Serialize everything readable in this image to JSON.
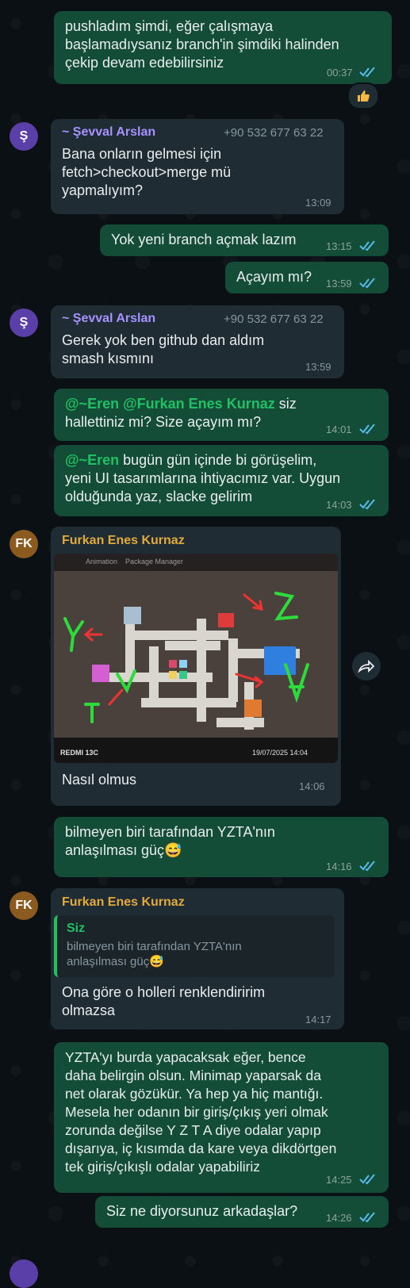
{
  "colors": {
    "outgoing": "#134d37",
    "incoming": "#1f2c33",
    "sevval": "#a792ff",
    "furkan": "#e2a93d",
    "mention": "#21c063",
    "read_ticks": "#53bdeb"
  },
  "messages": {
    "m1": {
      "text": "pushladım şimdi, eğer çalışmaya\nbaşlamadıysanız branch'in şimdiki halinden\nçekip devam edebilirsiniz",
      "time": "00:37"
    },
    "m2": {
      "avatar": "Ş",
      "sender": "~ Şevval Arslan",
      "phone": "+90 532 677 63 22",
      "text": "Bana onların gelmesi için\nfetch>checkout>merge mü\nyapmalıyım?",
      "time": "13:09"
    },
    "m3": {
      "text": "Yok yeni branch açmak lazım",
      "time": "13:15"
    },
    "m4": {
      "text": "Açayım mı?",
      "time": "13:59"
    },
    "m5": {
      "avatar": "Ş",
      "sender": "~ Şevval Arslan",
      "phone": "+90 532 677 63 22",
      "text": "Gerek yok ben github dan aldım\nsmash kısmını",
      "time": "13:59"
    },
    "m6": {
      "mention1": "@~Eren",
      "mention2": "@Furkan Enes Kurnaz",
      "text_a": " siz",
      "text_b": "hallettiniz mi? Size açayım mı?",
      "time": "14:01"
    },
    "m7": {
      "mention": "@~Eren",
      "text_a": " bugün gün içinde bi görüşelim,",
      "text_b": "yeni UI tasarımlarına ihtiyacımız var. Uygun\nolduğunda yaz, slacke gelirim",
      "time": "14:03"
    },
    "m8": {
      "avatar": "FK",
      "sender": "Furkan Enes Kurnaz",
      "photo_tabs": [
        "Animation",
        "Package Manager"
      ],
      "photo_phone": "REDMI 13C",
      "photo_date": "19/07/2025 14:04",
      "photo_letters": [
        "Y",
        "Z",
        "A",
        "T"
      ],
      "caption": "Nasıl olmus",
      "time": "14:06"
    },
    "m9": {
      "text": "bilmeyen biri tarafından YZTA'nın\nanlaşılması güç",
      "emoji": "😅",
      "time": "14:16"
    },
    "m10": {
      "avatar": "FK",
      "sender": "Furkan Enes Kurnaz",
      "quote_sender": "Siz",
      "quote_text": "bilmeyen biri tarafından YZTA'nın\nanlaşılması güç",
      "quote_emoji": "😅",
      "text": "Ona göre o holleri renklendiririm\nolmazsa",
      "time": "14:17"
    },
    "m11": {
      "text": "YZTA'yı burda yapacaksak eğer, bence\ndaha belirgin olsun. Minimap yaparsak da\nnet olarak gözükür. Ya hep ya hiç mantığı.\nMesela her odanın bir giriş/çıkış yeri olmak\nzorunda değilse Y Z T A diye odalar yapıp\ndışarıya, iç kısımda da kare veya dikdörtgen\ntek giriş/çıkışlı odalar yapabiliriz",
      "time": "14:25"
    },
    "m12": {
      "text": "Siz ne diyorsunuz arkadaşlar?",
      "time": "14:26"
    }
  },
  "icons": {
    "reaction": "thumbs-up-icon",
    "forward": "forward-icon",
    "read": "double-check-icon"
  }
}
